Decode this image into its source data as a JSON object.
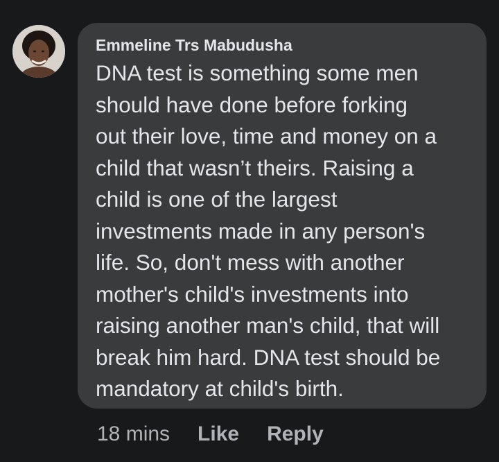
{
  "comment": {
    "author": "Emmeline Trs Mabudusha",
    "text": "DNA test is something some men\nshould have done before forking\nout their love, time and money on a\nchild that wasn’t theirs. Raising a\nchild is one of the largest\ninvestments made in any person's\nlife. So, don't mess with another\nmother's child's investments into\nraising another man's child, that will\nbreak him hard. DNA test should be\nmandatory at child's birth.",
    "timestamp": "18 mins",
    "like_label": "Like",
    "reply_label": "Reply"
  },
  "colors": {
    "background": "#18191a",
    "bubble": "#3a3b3c",
    "text": "#e4e6eb",
    "secondary_text": "#b0b3b8"
  }
}
